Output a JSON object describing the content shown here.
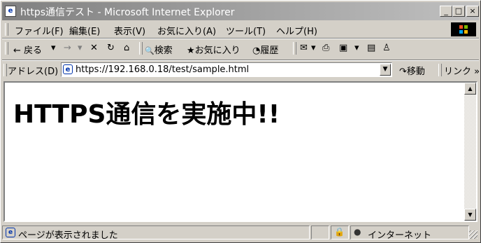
{
  "window": {
    "title": "https通信テスト - Microsoft Internet Explorer",
    "icon": "ie-page-icon",
    "buttons": {
      "minimize": "_",
      "maximize": "□",
      "close": "×"
    }
  },
  "menubar": {
    "items": [
      {
        "label": "ファイル(F)"
      },
      {
        "label": "編集(E)"
      },
      {
        "label": "表示(V)"
      },
      {
        "label": "お気に入り(A)"
      },
      {
        "label": "ツール(T)"
      },
      {
        "label": "ヘルプ(H)"
      }
    ]
  },
  "toolbar": {
    "back_icon": "←",
    "back_label": "戻る",
    "back_dropdown": "▾",
    "forward_icon": "→",
    "forward_dropdown": "▾",
    "stop_icon": "✕",
    "refresh_icon": "↻",
    "home_icon": "⌂",
    "search_icon": "🔍",
    "search_label": "検索",
    "favorites_icon": "★",
    "favorites_label": "お気に入り",
    "history_icon": "◔",
    "history_label": "履歴",
    "mail_icon": "✉",
    "mail_dropdown": "▾",
    "print_icon": "⎙",
    "edit_icon": "▣",
    "edit_dropdown": "▾",
    "discuss_icon": "▤",
    "messenger_icon": "♙"
  },
  "addressbar": {
    "label": "アドレス(D)",
    "url": "https://192.168.0.18/test/sample.html",
    "dropdown": "▼",
    "go_icon": "↷",
    "go_label": "移動",
    "links_label": "リンク",
    "links_more": "»"
  },
  "content": {
    "heading": "HTTPS通信を実施中!!"
  },
  "scrollbar": {
    "up": "▲",
    "down": "▼"
  },
  "statusbar": {
    "message": "ページが表示されました",
    "zone_label": "インターネット",
    "lock_icon": "🔒",
    "zone_icon": "●"
  }
}
